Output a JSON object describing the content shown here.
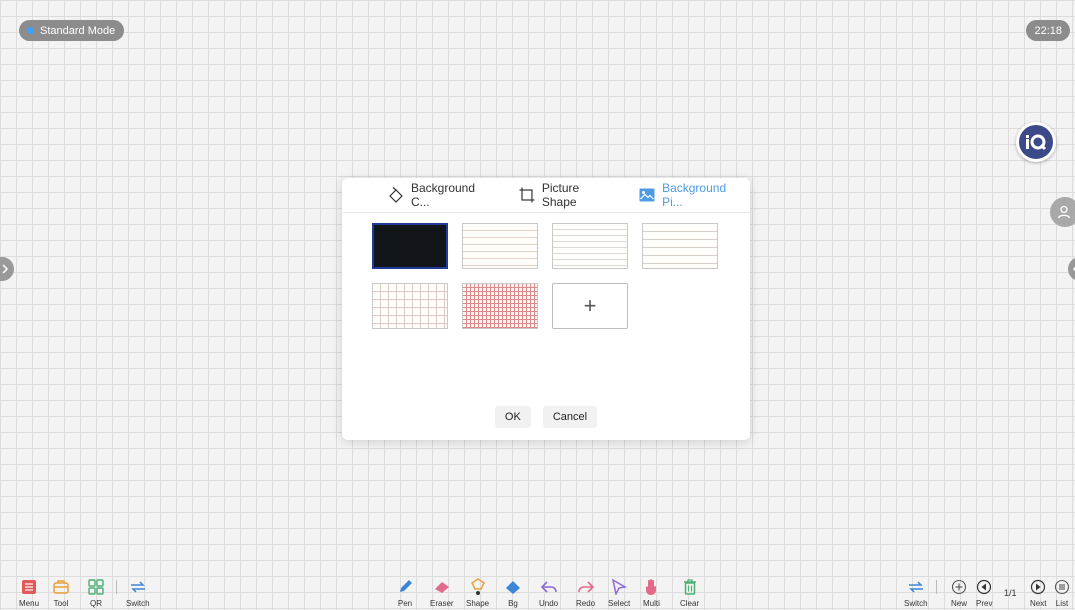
{
  "status": {
    "mode_label": "Standard Mode",
    "time": "22:18"
  },
  "brand": {
    "iq_label": "iQ"
  },
  "dialog": {
    "tabs": [
      {
        "label": "Background C...",
        "icon": "fill-color-icon",
        "active": false
      },
      {
        "label": "Picture Shape",
        "icon": "crop-frame-icon",
        "active": false
      },
      {
        "label": "Background Pi...",
        "icon": "image-icon",
        "active": true
      }
    ],
    "backgrounds": [
      "black",
      "lined-red",
      "lined-gray",
      "lined-wide",
      "grid-light",
      "grid-red"
    ],
    "add_label": "+",
    "ok_label": "OK",
    "cancel_label": "Cancel"
  },
  "toolbar": {
    "left": [
      {
        "label": "Menu",
        "icon": "menu-icon"
      },
      {
        "label": "Tool",
        "icon": "toolbox-icon"
      },
      {
        "label": "QR",
        "icon": "qr-icon"
      },
      {
        "label": "Switch",
        "icon": "switch-icon"
      }
    ],
    "center": [
      {
        "label": "Pen",
        "icon": "pen-icon"
      },
      {
        "label": "Eraser",
        "icon": "eraser-icon"
      },
      {
        "label": "Shape",
        "icon": "shape-icon"
      },
      {
        "label": "Bg",
        "icon": "bg-icon"
      },
      {
        "label": "Undo",
        "icon": "undo-icon"
      },
      {
        "label": "Redo",
        "icon": "redo-icon"
      },
      {
        "label": "Select",
        "icon": "select-icon"
      },
      {
        "label": "Multi",
        "icon": "multi-touch-icon"
      },
      {
        "label": "Clear",
        "icon": "trash-icon"
      }
    ],
    "right": [
      {
        "label": "Switch",
        "icon": "switch-icon"
      },
      {
        "label": "New",
        "icon": "plus-circle-icon"
      },
      {
        "label": "Prev",
        "icon": "prev-icon"
      },
      {
        "label": "Next",
        "icon": "next-icon"
      },
      {
        "label": "List",
        "icon": "list-icon"
      }
    ],
    "page_indicator": "1/1"
  },
  "colors": {
    "accent": "#4d9be6",
    "toolbar_red": "#e05a5a",
    "toolbar_orange": "#e8a03c",
    "toolbar_green": "#4caf74",
    "toolbar_blue": "#3c86d8",
    "toolbar_pink": "#e26a8a",
    "toolbar_purple": "#8e6ad8",
    "iq_bg": "#3d4a8a"
  }
}
